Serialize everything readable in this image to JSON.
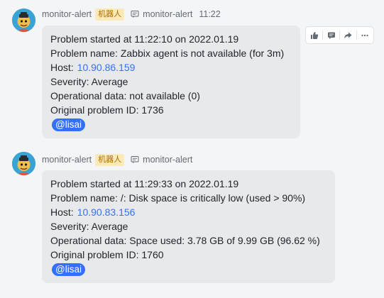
{
  "messages": [
    {
      "sender": "monitor-alert",
      "badge": "机器人",
      "channel": "monitor-alert",
      "time": "11:22",
      "lines": {
        "started": "Problem started at 11:22:10 on 2022.01.19",
        "name": "Problem name: Zabbix agent is not available (for 3m)",
        "host_label": "Host:",
        "host_ip": "10.90.86.159",
        "severity": "Severity: Average",
        "opdata": "Operational data: not available (0)",
        "problem_id": "Original problem ID: 1736",
        "mention": "@lisai"
      }
    },
    {
      "sender": "monitor-alert",
      "badge": "机器人",
      "channel": "monitor-alert",
      "lines": {
        "started": "Problem started at 11:29:33 on 2022.01.19",
        "name": "Problem name: /: Disk space is critically low (used > 90%)",
        "host_label": "Host:",
        "host_ip": "10.90.83.156",
        "severity": "Severity: Average",
        "opdata": "Operational data: Space used: 3.78 GB of 9.99 GB (96.62 %)",
        "problem_id": "Original problem ID: 1760",
        "mention": "@lisai"
      }
    }
  ],
  "toolbar": {
    "icons": [
      "thumbs-up-icon",
      "reply-icon",
      "forward-icon",
      "more-icon"
    ]
  },
  "colors": {
    "link": "#3370ff",
    "badge_bg": "#fbe9b7",
    "bubble_bg": "#e8e9eb"
  }
}
